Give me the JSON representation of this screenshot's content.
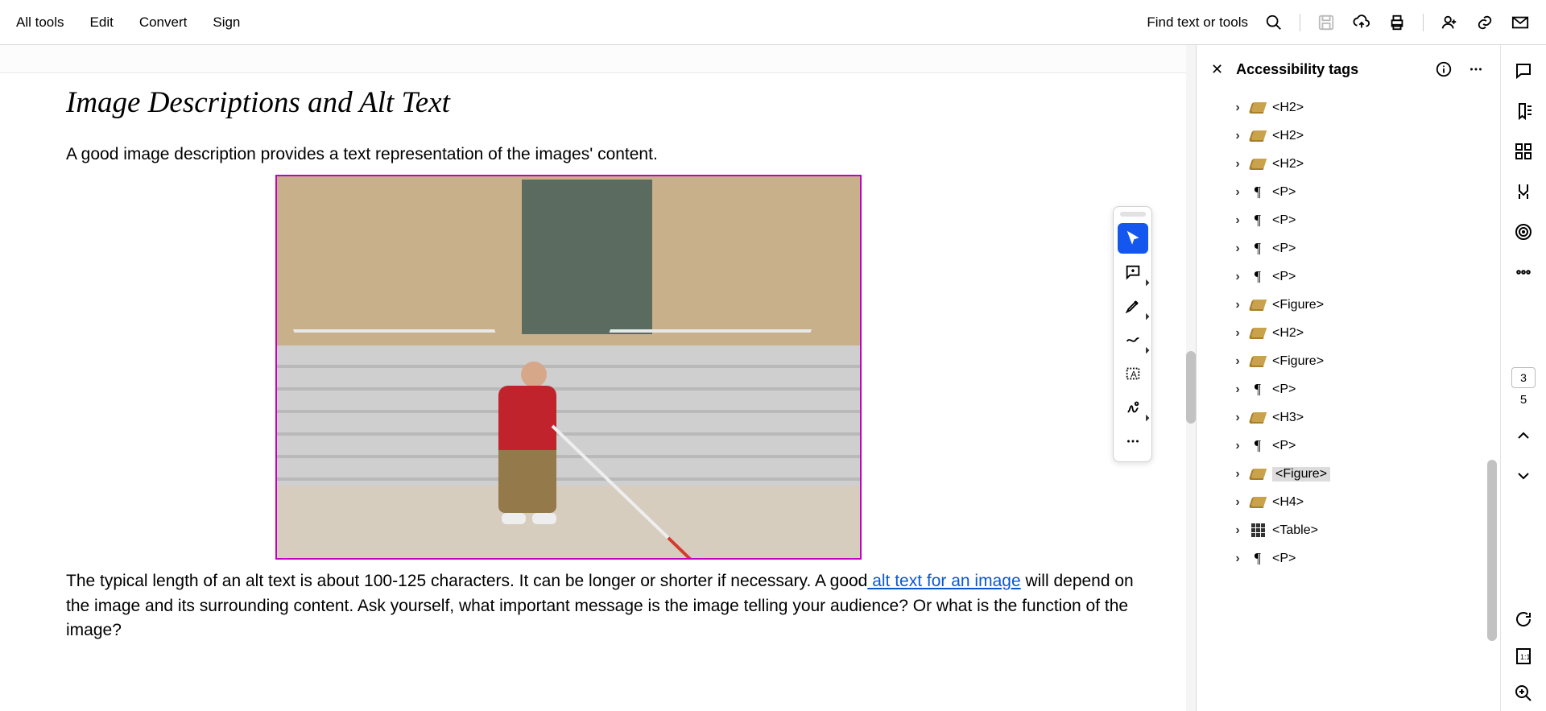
{
  "toolbar": {
    "left": [
      "All tools",
      "Edit",
      "Convert",
      "Sign"
    ],
    "find_label": "Find text or tools"
  },
  "document": {
    "title": "Image Descriptions and Alt Text",
    "p1": "A good image description provides a text representation of the images' content.",
    "p2a": "The typical length of an alt text is about 100-125 characters. It can be longer or shorter if necessary. A good",
    "p2link": " alt text for an image",
    "p2b": " will depend on the image and its surrounding content. Ask yourself, what important message is the image telling your audience? Or what is the function of the image?"
  },
  "accessibility_panel": {
    "title": "Accessibility tags",
    "tags": [
      {
        "type": "tag",
        "label": "<H2>"
      },
      {
        "type": "tag",
        "label": "<H2>"
      },
      {
        "type": "tag",
        "label": "<H2>"
      },
      {
        "type": "para",
        "label": "<P>"
      },
      {
        "type": "para",
        "label": "<P>"
      },
      {
        "type": "para",
        "label": "<P>"
      },
      {
        "type": "para",
        "label": "<P>"
      },
      {
        "type": "tag",
        "label": "<Figure>"
      },
      {
        "type": "tag",
        "label": "<H2>"
      },
      {
        "type": "tag",
        "label": "<Figure>"
      },
      {
        "type": "para",
        "label": "<P>"
      },
      {
        "type": "tag",
        "label": "<H3>"
      },
      {
        "type": "para",
        "label": "<P>"
      },
      {
        "type": "tag",
        "label": "<Figure>",
        "selected": true
      },
      {
        "type": "tag",
        "label": "<H4>"
      },
      {
        "type": "table",
        "label": "<Table>"
      },
      {
        "type": "para",
        "label": "<P>"
      }
    ]
  },
  "page_nav": {
    "current": "3",
    "total": "5"
  }
}
